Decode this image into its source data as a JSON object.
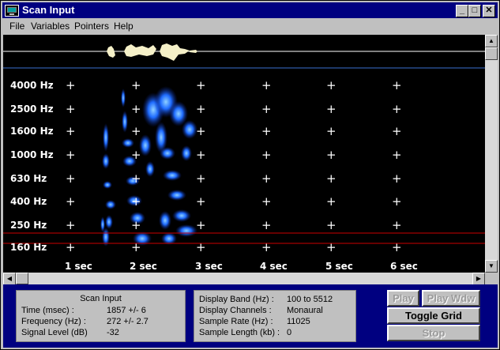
{
  "window": {
    "title": "Scan Input"
  },
  "menu": [
    "File",
    "Variables",
    "Pointers",
    "Help"
  ],
  "window_buttons": {
    "minimize": "_",
    "maximize": "□",
    "close": "✕"
  },
  "spectrogram": {
    "freq_labels": [
      "4000 Hz",
      "2500 Hz",
      "1600 Hz",
      "1000 Hz",
      "630 Hz",
      "400 Hz",
      "250 Hz",
      "160 Hz"
    ],
    "time_labels": [
      "1  sec",
      "2  sec",
      "3  sec",
      "4  sec",
      "5  sec",
      "6  sec"
    ],
    "grid_marker": "+"
  },
  "scan_panel": {
    "title": "Scan Input",
    "rows": [
      {
        "label": "Time (msec) :",
        "value": "1857 +/- 6"
      },
      {
        "label": "Frequency (Hz) :",
        "value": "272  +/- 2.7"
      },
      {
        "label": "Signal Level (dB)",
        "value": "-32"
      }
    ]
  },
  "display_panel": {
    "rows": [
      {
        "label": "Display Band (Hz) :",
        "value": "100 to 5512"
      },
      {
        "label": "Display Channels :",
        "value": "Monaural"
      },
      {
        "label": "Sample Rate (Hz) :",
        "value": "11025"
      },
      {
        "label": "Sample Length (kb) :",
        "value": "0"
      }
    ]
  },
  "buttons": {
    "play": "Play",
    "play_wdw": "Play Wdw",
    "toggle_grid": "Toggle Grid",
    "stop": "Stop"
  },
  "colors": {
    "titlebar": "#000080",
    "canvas_bg": "#000000",
    "spectrogram": "#1e6bff",
    "cursor_red": "#cc0000",
    "cursor_blue": "#3a6fd0",
    "status_bg": "#000080"
  }
}
